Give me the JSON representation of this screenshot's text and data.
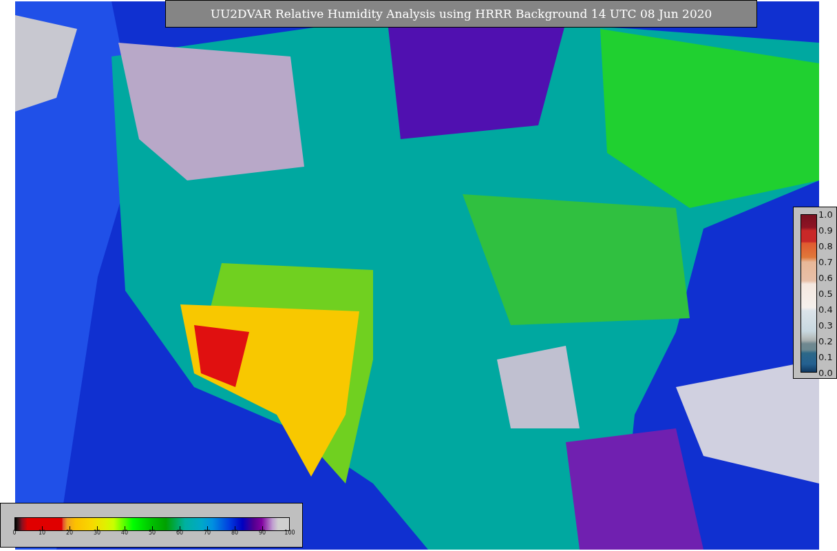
{
  "title": "UU2DVAR Relative Humidity Analysis using HRRR Background 14 UTC 08 Jun 2020",
  "humidity_colorbar": {
    "ticks": [
      "0",
      "10",
      "20",
      "30",
      "40",
      "50",
      "60",
      "70",
      "80",
      "90",
      "100"
    ]
  },
  "ratio_colorbar": {
    "ticks": [
      "1.0",
      "0.9",
      "0.8",
      "0.7",
      "0.6",
      "0.5",
      "0.4",
      "0.3",
      "0.2",
      "0.1",
      "0.0"
    ]
  }
}
